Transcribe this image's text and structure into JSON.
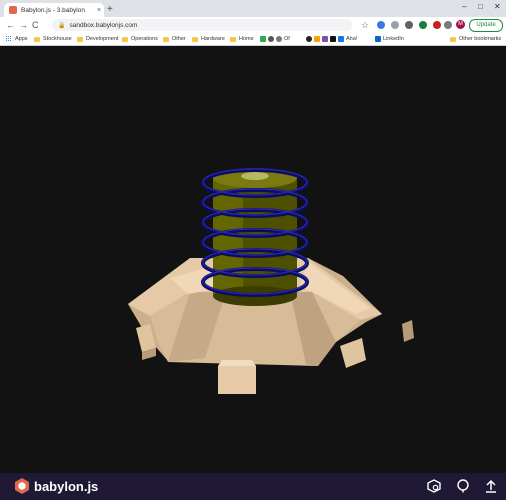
{
  "tab": {
    "title": "Babylon.js - 3.babylon",
    "close": "×",
    "new": "+"
  },
  "window": {
    "minimize": "–",
    "maximize": "□",
    "close": "✕"
  },
  "nav": {
    "back": "←",
    "forward": "→",
    "reload": "C",
    "home": "⌂"
  },
  "address": {
    "url": "sandbox.babylonjs.com"
  },
  "profile": {
    "initial": "M"
  },
  "update_label": "Update",
  "bookmarks": [
    {
      "label": "Apps",
      "icon": "apps-icon"
    },
    {
      "label": "Stockhouse",
      "icon": "folder-icon"
    },
    {
      "label": "Development",
      "icon": "folder-icon"
    },
    {
      "label": "Operations",
      "icon": "folder-icon"
    },
    {
      "label": "Other",
      "icon": "folder-icon"
    },
    {
      "label": "Hardware",
      "icon": "folder-icon"
    },
    {
      "label": "Home",
      "icon": "folder-icon"
    },
    {
      "label": "Of",
      "icon": "site-icon"
    },
    {
      "label": "Aha!",
      "icon": "site-icon"
    },
    {
      "label": "LinkedIn",
      "icon": "linkedin-icon"
    },
    {
      "label": "Other bookmarks",
      "icon": "folder-icon"
    }
  ],
  "footer": {
    "brand": "babylon.js"
  },
  "colors": {
    "footer_bg": "#201936",
    "viewport_bg": "#121212",
    "base": "#e6c9a6",
    "core": "#6b6b00",
    "coil": "#0a0a60"
  }
}
